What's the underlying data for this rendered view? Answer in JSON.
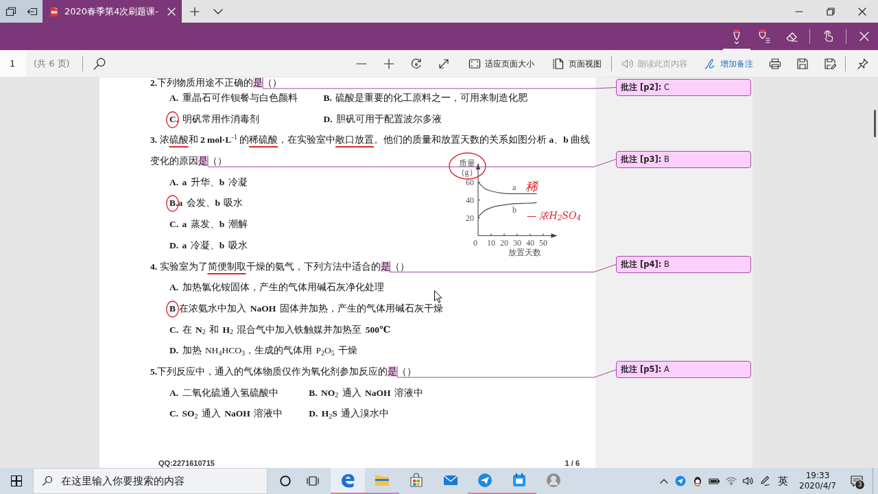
{
  "browser": {
    "tabs": [
      {
        "title": "2020春季第4次刷题课-",
        "selected": true
      }
    ]
  },
  "ink_tools": [
    {
      "kind": "pen",
      "selected": true
    },
    {
      "kind": "highlighter",
      "selected": false
    },
    {
      "kind": "eraser",
      "selected": false
    },
    {
      "kind": "touch",
      "selected": false
    }
  ],
  "pdf_toolbar": {
    "page": "1",
    "page_total": "(共 6 页)",
    "actions": [
      {
        "kind": "fit",
        "label": "适应页面大小",
        "disabled": false,
        "active": false
      },
      {
        "kind": "view",
        "label": "页面视图",
        "disabled": false,
        "active": false
      },
      {
        "kind": "read",
        "label": "朗读此页内容",
        "disabled": true,
        "active": false
      },
      {
        "kind": "note",
        "label": "增加备注",
        "disabled": false,
        "active": true
      }
    ]
  },
  "document": {
    "questions": [
      {
        "kind": "grid",
        "lines": [
          [
            {
              "kind": "plain",
              "text": "**2.**下列物质用途不正确的"
            },
            {
              "kind": "highlight",
              "text": "是"
            },
            {
              "kind": "plain",
              "text": "（）"
            }
          ]
        ],
        "comment": "**批注 [p2]:** C",
        "options": [
          {
            "text": "**A.** 重晶石可作钡餐与白色颜料",
            "circled": false
          },
          {
            "text": "**B.** 硫酸是重要的化工原料之一，可用来制造化肥",
            "circled": false
          },
          {
            "text": "**C.** 明矾常用作消毒剂",
            "circled": true
          },
          {
            "text": "**D.** 胆矾可用于配置波尔多液",
            "circled": false
          }
        ]
      },
      {
        "kind": "list",
        "lines": [
          [
            {
              "kind": "plain",
              "text": "**3.** 浓"
            },
            {
              "kind": "underline",
              "text": "硫酸"
            },
            {
              "kind": "plain",
              "text": "和 **2 mol·L**$^{-1}$ 的"
            },
            {
              "kind": "underline",
              "text": "稀硫酸"
            },
            {
              "kind": "plain",
              "text": "，在实验室中"
            },
            {
              "kind": "underline",
              "text": "敞口放置"
            },
            {
              "kind": "plain",
              "text": "。他们的质量和放置天数的关系如图分析 **a**、**b** 曲线"
            }
          ],
          [
            {
              "kind": "plain",
              "text": "变化的原因"
            },
            {
              "kind": "highlight",
              "text": "是"
            },
            {
              "kind": "plain",
              "text": "（）"
            }
          ]
        ],
        "comment": "**批注 [p3]:** B",
        "options": [
          {
            "text": "**A. a** 升华、**b** 冷凝",
            "circled": false
          },
          {
            "text": "**B.a** 会发、**b** 吸水",
            "circled": true
          },
          {
            "text": "**C. a** 蒸发、**b** 潮解",
            "circled": false
          },
          {
            "text": "**D. a** 冷凝、**b** 吸水",
            "circled": false
          }
        ],
        "graph": {
          "chart_data": {
            "type": "line",
            "xlabel": "放置天数",
            "ylabel": "质量（g）",
            "x": [
              0,
              5,
              10,
              20,
              30,
              40,
              45
            ],
            "series": [
              {
                "name": "a",
                "color": "#4d4d4d",
                "values": [
                  60,
                  53,
                  50,
                  47.5,
                  47,
                  47,
                  47
                ]
              },
              {
                "name": "b",
                "color": "#4d4d4d",
                "values": [
                  21,
                  28,
                  31.5,
                  34.5,
                  36,
                  36.5,
                  37
                ]
              }
            ],
            "xticks": [
              0,
              10,
              20,
              30,
              40,
              50
            ],
            "yticks": [
              20,
              40,
              60
            ],
            "xlim": [
              0,
              60
            ],
            "ylim": [
              0,
              80
            ]
          },
          "label_circled": true,
          "notes": [
            "稀",
            "— 浓H$_{2}$SO$_{4}$"
          ]
        }
      },
      {
        "kind": "list",
        "lines": [
          [
            {
              "kind": "plain",
              "text": "**4.** 实验室为了"
            },
            {
              "kind": "underline",
              "text": "简便制取"
            },
            {
              "kind": "plain",
              "text": "干燥的氨气，下列方法中适合的"
            },
            {
              "kind": "highlight",
              "text": "是"
            },
            {
              "kind": "plain",
              "text": "（）"
            }
          ]
        ],
        "comment": "**批注 [p4]:** B",
        "options": [
          {
            "text": "**A.** 加热氯化铵固体，产生的气体用碱石灰净化处理",
            "circled": false
          },
          {
            "text": "**B** 在浓氨水中加入 **NaOH** 固体并加热，产生的气体用碱石灰干燥",
            "circled": true
          },
          {
            "text": "**C.** 在 **N**$_{2}$ 和 **H**$_{2}$ 混合气中加入铁触媒并加热至 **500℃**",
            "circled": false
          },
          {
            "text": "**D.** 加热 NH$_{4}$HCO$_{3}$，生成的气体用 P$_{2}$O$_{5}$ 干燥",
            "circled": false
          }
        ]
      },
      {
        "kind": "grid",
        "lines": [
          [
            {
              "kind": "plain",
              "text": "**5.**下列反应中，通入的气体物质仅作为氧化剂参加反应的"
            },
            {
              "kind": "highlight",
              "text": "是"
            },
            {
              "kind": "plain",
              "text": "（）"
            }
          ]
        ],
        "comment": "**批注 [p5]:** A",
        "options": [
          {
            "text": "**A.** 二氧化硫通入氢硫酸中",
            "circled": false
          },
          {
            "text": "**B. NO**$_{2}$ 通入 **NaOH** 溶液中",
            "circled": false
          },
          {
            "text": "**C. SO**$_{2}$ 通入 **NaOH** 溶液中",
            "circled": false
          },
          {
            "text": "**D. H**$_{2}$**S** 通入溴水中",
            "circled": false
          }
        ]
      }
    ],
    "footer": {
      "left": "QQ:2271610715",
      "right": "1 / 6"
    }
  },
  "taskbar": {
    "search": {
      "placeholder": "在这里输入你要搜索的内容"
    },
    "apps": [
      {
        "kind": "edge",
        "selected": true,
        "running": true
      },
      {
        "kind": "explorer",
        "selected": false,
        "running": true
      },
      {
        "kind": "store",
        "selected": false,
        "running": false
      },
      {
        "kind": "mail",
        "selected": false,
        "running": false
      },
      {
        "kind": "plane",
        "selected": false,
        "running": true
      },
      {
        "kind": "calendar",
        "selected": false,
        "running": true
      },
      {
        "kind": "avatar",
        "selected": false,
        "running": false
      }
    ],
    "ime": "英",
    "time": "19:33",
    "date": "2020/4/7",
    "notifications": "3"
  }
}
